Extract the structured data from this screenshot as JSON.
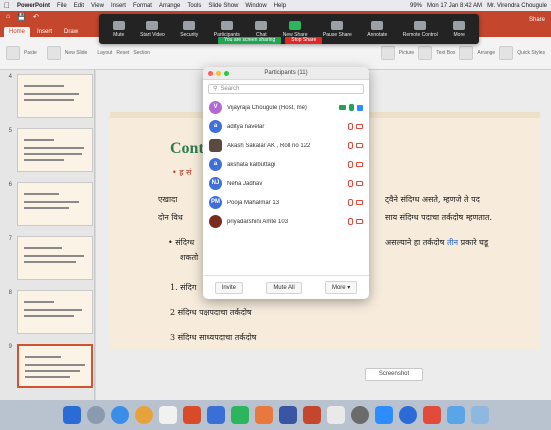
{
  "menubar": {
    "app": "PowerPoint",
    "items": [
      "File",
      "Edit",
      "View",
      "Insert",
      "Format",
      "Arrange",
      "Tools",
      "Slide Show",
      "Window",
      "Help"
    ],
    "battery": "99%",
    "datetime": "Mon 17 Jan  8:42 AM",
    "user": "Mr. Virendra Chougule"
  },
  "ribbon": {
    "tabs": [
      "Home",
      "Insert",
      "Draw"
    ],
    "active_tab": "Home",
    "share": "Share",
    "groups": [
      "Paste",
      "New Slide",
      "Layout",
      "Reset",
      "Section",
      "Picture",
      "Text Box",
      "Arrange",
      "Quick Styles"
    ]
  },
  "zoom_toolbar": {
    "items": [
      "Mute",
      "Start Video",
      "Security",
      "Participants",
      "Chat",
      "New Share",
      "Pause Share",
      "Annotate",
      "Remote Control",
      "More"
    ],
    "participant_count": "11",
    "viewing_label": "You are screen sharing",
    "stop_share": "Stop Share",
    "accent": "#2d8cff",
    "stop_color": "#e02828"
  },
  "participants_panel": {
    "title": "Participants (11)",
    "search_placeholder": "Search",
    "participants": [
      {
        "initial": "V",
        "name": "Vijayraja Chougule (Host, me)",
        "color": "#b06ad6",
        "mic": "on",
        "cam": "on"
      },
      {
        "initial": "a",
        "name": "aditya navelar",
        "color": "#3f6fd8",
        "mic": "off",
        "cam": "off"
      },
      {
        "initial": "",
        "name": "Akash Sakalar AK , Roll no 122",
        "color": "#5a4a42",
        "mic": "off",
        "cam": "off",
        "photo": true
      },
      {
        "initial": "a",
        "name": "akshata kalbuttagi",
        "color": "#3f6fd8",
        "mic": "off",
        "cam": "off"
      },
      {
        "initial": "NJ",
        "name": "Neha Jadhav",
        "color": "#3f6fd8",
        "mic": "off",
        "cam": "off"
      },
      {
        "initial": "PM",
        "name": "Pooja Mahalmar 13",
        "color": "#3f6fd8",
        "mic": "off",
        "cam": "off"
      },
      {
        "initial": "",
        "name": "priyadarshini Amte 103",
        "color": "#7a2a20",
        "mic": "off",
        "cam": "off",
        "photo": true
      }
    ],
    "footer": {
      "invite": "Invite",
      "mute_all": "Mute All",
      "more": "More ▾"
    }
  },
  "slide": {
    "title": "Cont",
    "lines": [
      "• ह्र सं",
      "एखादा",
      "ट्वैने संदिग्ध असते, म्हणजे ते पद",
      "दोन विध",
      "साय संदिग्ध पदाचा तर्कदोष म्हणतात.",
      "• संदिग्ध",
      "असल्याने हा तर्कदोष",
      "तीन",
      "प्रकारे घडू",
      "शकतो",
      "1. संदिग",
      "2 संदिग्ध पक्षपदाचा तर्कदोष",
      "3 संदिग्ध साध्यपदाचा तर्कदोष"
    ]
  },
  "sidebar": {
    "slide_numbers": [
      "4",
      "5",
      "6",
      "7",
      "8",
      "9"
    ],
    "active_slide": "9"
  },
  "screenshot_button": "Screenshot"
}
